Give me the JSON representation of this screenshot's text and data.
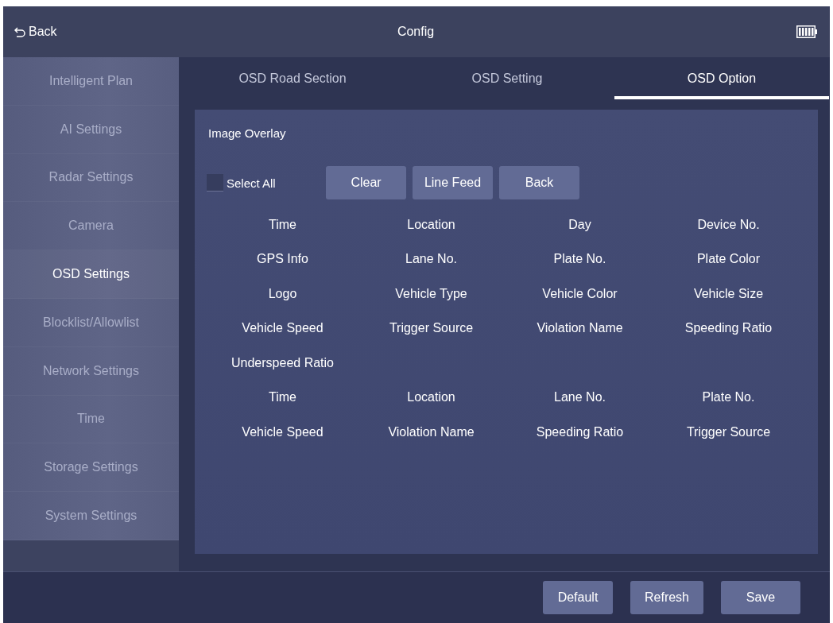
{
  "header": {
    "back": "Back",
    "title": "Config"
  },
  "sidebar": {
    "items": [
      {
        "label": "Intelligent Plan",
        "selected": false
      },
      {
        "label": "AI Settings",
        "selected": false
      },
      {
        "label": "Radar Settings",
        "selected": false
      },
      {
        "label": "Camera",
        "selected": false
      },
      {
        "label": "OSD Settings",
        "selected": true
      },
      {
        "label": "Blocklist/Allowlist",
        "selected": false
      },
      {
        "label": "Network Settings",
        "selected": false
      },
      {
        "label": "Time",
        "selected": false
      },
      {
        "label": "Storage Settings",
        "selected": false
      },
      {
        "label": "System Settings",
        "selected": false
      }
    ]
  },
  "tabs": [
    {
      "label": "OSD Road Section",
      "selected": false
    },
    {
      "label": "OSD Setting",
      "selected": false
    },
    {
      "label": "OSD Option",
      "selected": true
    }
  ],
  "panel": {
    "title": "Image Overlay",
    "select_all": {
      "label": "Select All",
      "checked": false
    },
    "buttons": [
      "Clear",
      "Line Feed",
      "Back"
    ],
    "rows": [
      [
        "Time",
        "Location",
        "Day",
        "Device No."
      ],
      [
        "GPS Info",
        "Lane No.",
        "Plate No.",
        "Plate Color"
      ],
      [
        "Logo",
        "Vehicle Type",
        "Vehicle Color",
        "Vehicle Size"
      ],
      [
        "Vehicle Speed",
        "Trigger Source",
        "Violation Name",
        "Speeding Ratio"
      ],
      [
        "Underspeed Ratio"
      ],
      [
        "Time",
        "Location",
        "Lane No.",
        "Plate No."
      ],
      [
        "Vehicle Speed",
        "Violation Name",
        "Speeding Ratio",
        "Trigger Source"
      ]
    ]
  },
  "footer": {
    "buttons": [
      "Default",
      "Refresh",
      "Save"
    ]
  }
}
